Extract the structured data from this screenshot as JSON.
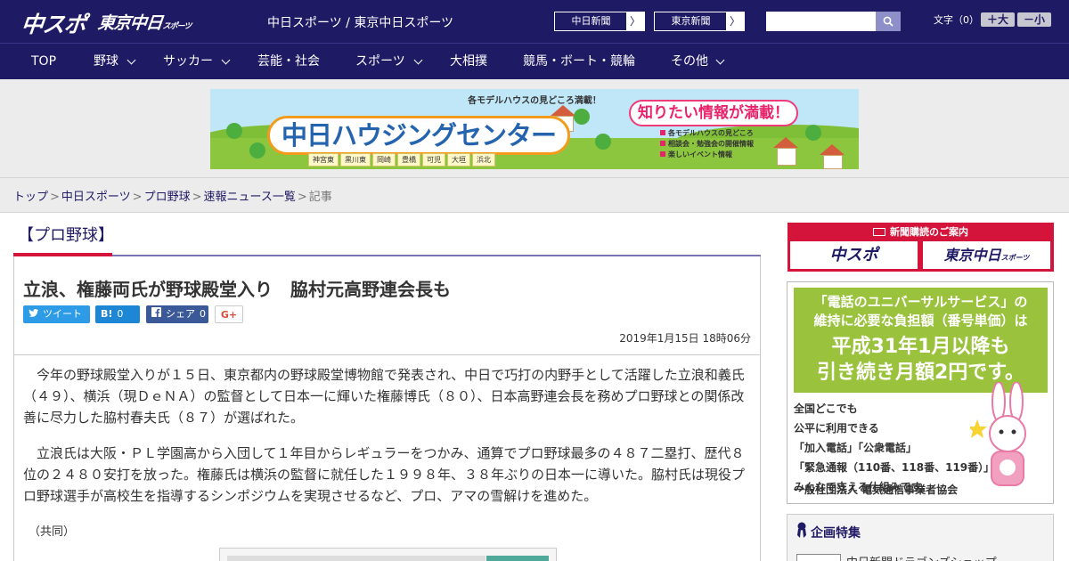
{
  "header": {
    "logo_chunichi": "中スポ",
    "logo_tokyo": "東京中日",
    "logo_tokyo_sub": "スポーツ",
    "site_title": "中日スポーツ / 東京中日スポーツ",
    "ext_link_1": "中日新聞",
    "ext_link_2": "東京新聞",
    "arrow": "〉",
    "search_placeholder": "",
    "text_size_label": "文字（0）",
    "size_up": "＋大",
    "size_down": "－小"
  },
  "nav": {
    "items": [
      {
        "label": "TOP",
        "dropdown": false
      },
      {
        "label": "野球",
        "dropdown": true
      },
      {
        "label": "サッカー",
        "dropdown": true
      },
      {
        "label": "芸能・社会",
        "dropdown": false
      },
      {
        "label": "スポーツ",
        "dropdown": true
      },
      {
        "label": "大相撲",
        "dropdown": false
      },
      {
        "label": "競馬・ボート・競輪",
        "dropdown": false
      },
      {
        "label": "その他",
        "dropdown": true
      }
    ]
  },
  "banner": {
    "tagline": "各モデルハウスの見どころ満載！",
    "title": "中日ハウジングセンター",
    "bubble": "知りたい情報が満載！",
    "towns": [
      "神宮東",
      "黒川東",
      "岡崎",
      "豊橋",
      "可児",
      "大垣",
      "浜北"
    ],
    "info_1": "各モデルハウスの見どころ",
    "info_2": "相談会・勉強会の開催情報",
    "info_3": "楽しいイベント情報"
  },
  "breadcrumb": {
    "items": [
      "トップ",
      "中日スポーツ",
      "プロ野球",
      "速報ニュース一覧"
    ],
    "current": "記事",
    "separator": ">"
  },
  "article": {
    "category": "【プロ野球】",
    "title": "立浪、権藤両氏が野球殿堂入り　脇村元高野連会長も",
    "share_tweet": "ツイート",
    "share_hatena_icon": "B!",
    "share_hatena_count": "0",
    "share_fb": "シェア",
    "share_fb_count": "0",
    "share_gplus": "G+",
    "date": "2019年1月15日 18時06分",
    "paragraphs": [
      "今年の野球殿堂入りが１５日、東京都内の野球殿堂博物館で発表され、中日で巧打の内野手として活躍した立浪和義氏（４９）、横浜（現ＤｅＮＡ）の監督として日本一に輝いた権藤博氏（８０）、日本高野連会長を務めプロ野球との関係改善に尽力した脇村春夫氏（８７）が選ばれた。",
      "立浪氏は大阪・ＰＬ学園高から入団して１年目からレギュラーをつかみ、通算でプロ野球最多の４８７二塁打、歴代８位の２４８０安打を放った。権藤氏は横浜の監督に就任した１９９８年、３８年ぶりの日本一に導いた。脇村氏は現役プロ野球選手が高校生を指導するシンポジウムを実現させるなど、プロ、アマの雪解けを進めた。"
    ],
    "credit": "（共同）"
  },
  "sidebar": {
    "subscription_title": "新聞購読のご案内",
    "sub_chunichi": "中スポ",
    "sub_tokyo": "東京中日",
    "sub_tokyo_small": "スポーツ",
    "ad_line_1": "「電話のユニバーサルサービス」の",
    "ad_line_2": "維持に必要な負担額（番号単価）は",
    "ad_line_3": "平成31年1月以降も",
    "ad_line_4": "引き続き月額2円です。",
    "ad_body": [
      "全国どこでも",
      "公平に利用できる",
      "「加入電話」「公衆電話」",
      "「緊急通報（110番、118番、119番）」を",
      "みんなで支える仕組みです。"
    ],
    "ad_org": "一般社団法人 電気通信事業者協会",
    "feature_title": "企画特集",
    "feature_item": "中日新聞ドラゴンズショップ"
  },
  "colors": {
    "header_bg": "#1f1a64",
    "accent_red": "#d4143b",
    "divider_purple": "#7a74b4"
  }
}
